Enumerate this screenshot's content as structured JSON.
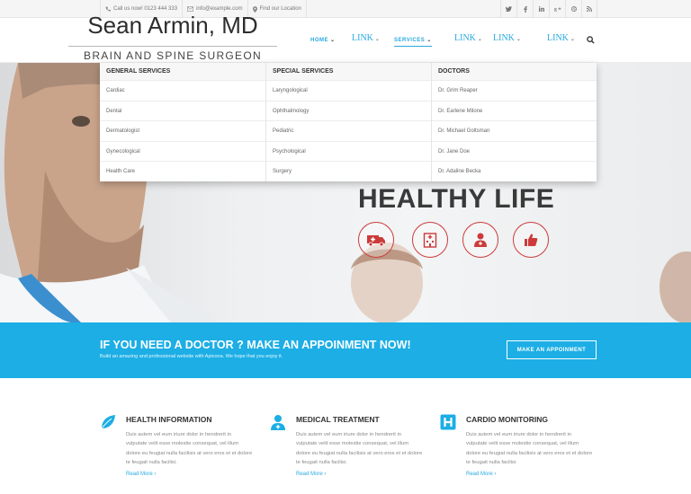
{
  "topbar": {
    "phone": "Call us now! 0123 444 333",
    "email": "info@example.com",
    "location": "Find our Location",
    "social_icons": [
      "twitter-icon",
      "facebook-icon",
      "linkedin-icon",
      "google-plus-icon",
      "dribbble-icon",
      "rss-icon"
    ]
  },
  "logo": {
    "name": "Sean Armin, MD",
    "subtitle": "BRAIN AND SPINE SURGEON"
  },
  "nav": {
    "home": "HOME",
    "link1": "LINK",
    "services": "SERVICES",
    "link2": "LINK",
    "link3": "LINK",
    "link4": "LINK"
  },
  "mega_menu": {
    "columns": [
      {
        "heading": "GENERAL SERVICES",
        "items": [
          "Cardiac",
          "Dental",
          "Dermatologist",
          "Gynecological",
          "Health Care"
        ]
      },
      {
        "heading": "SPECIAL SERVICES",
        "items": [
          "Laryngological",
          "Ophthalmology",
          "Pediatric",
          "Psychological",
          "Surgery"
        ]
      },
      {
        "heading": "DOCTORS",
        "items": [
          "Dr. Grim Reaper",
          "Dr. Earlene Milone",
          "Dr. Michael Goltsman",
          "Dr. Jane Doe",
          "Dr. Adaline Becka"
        ]
      }
    ]
  },
  "hero": {
    "title": "HEALTHY LIFE",
    "accent": "#cc3b3b"
  },
  "cta": {
    "title": "IF YOU NEED A DOCTOR ? MAKE AN APPOINMENT NOW!",
    "subtitle": "Build an amazing and professional website with Apicona. We hope that you enjoy it.",
    "button": "MAKE AN APPOINMENT",
    "color": "#1caee5"
  },
  "services": [
    {
      "title": "HEALTH INFORMATION",
      "icon": "leaf-icon",
      "text": "Duis autem vel eum iriure dolor in hendrerit in vulputate velit esse molestie consequat, vel illum dolore eu feugiat nulla facilisis at vero eros et et dolore te feugait nulla facilisi.",
      "more": "Read More ›"
    },
    {
      "title": "MEDICAL TREATMENT",
      "icon": "doctor-icon",
      "text": "Duis autem vel eum iriure dolor in hendrerit in vulputate velit esse molestie consequat, vel illum dolore eu feugiat nulla facilisis at vero eros et et dolore te feugait nulla facilisi.",
      "more": "Read More ›"
    },
    {
      "title": "CARDIO MONITORING",
      "icon": "hospital-h-icon",
      "text": "Duis autem vel eum iriure dolor in hendrerit in vulputate velit esse molestie consequat, vel illum dolore eu feugiat nulla facilisis at vero eros et et dolore te feugait nulla facilisi.",
      "more": "Read More ›"
    }
  ]
}
